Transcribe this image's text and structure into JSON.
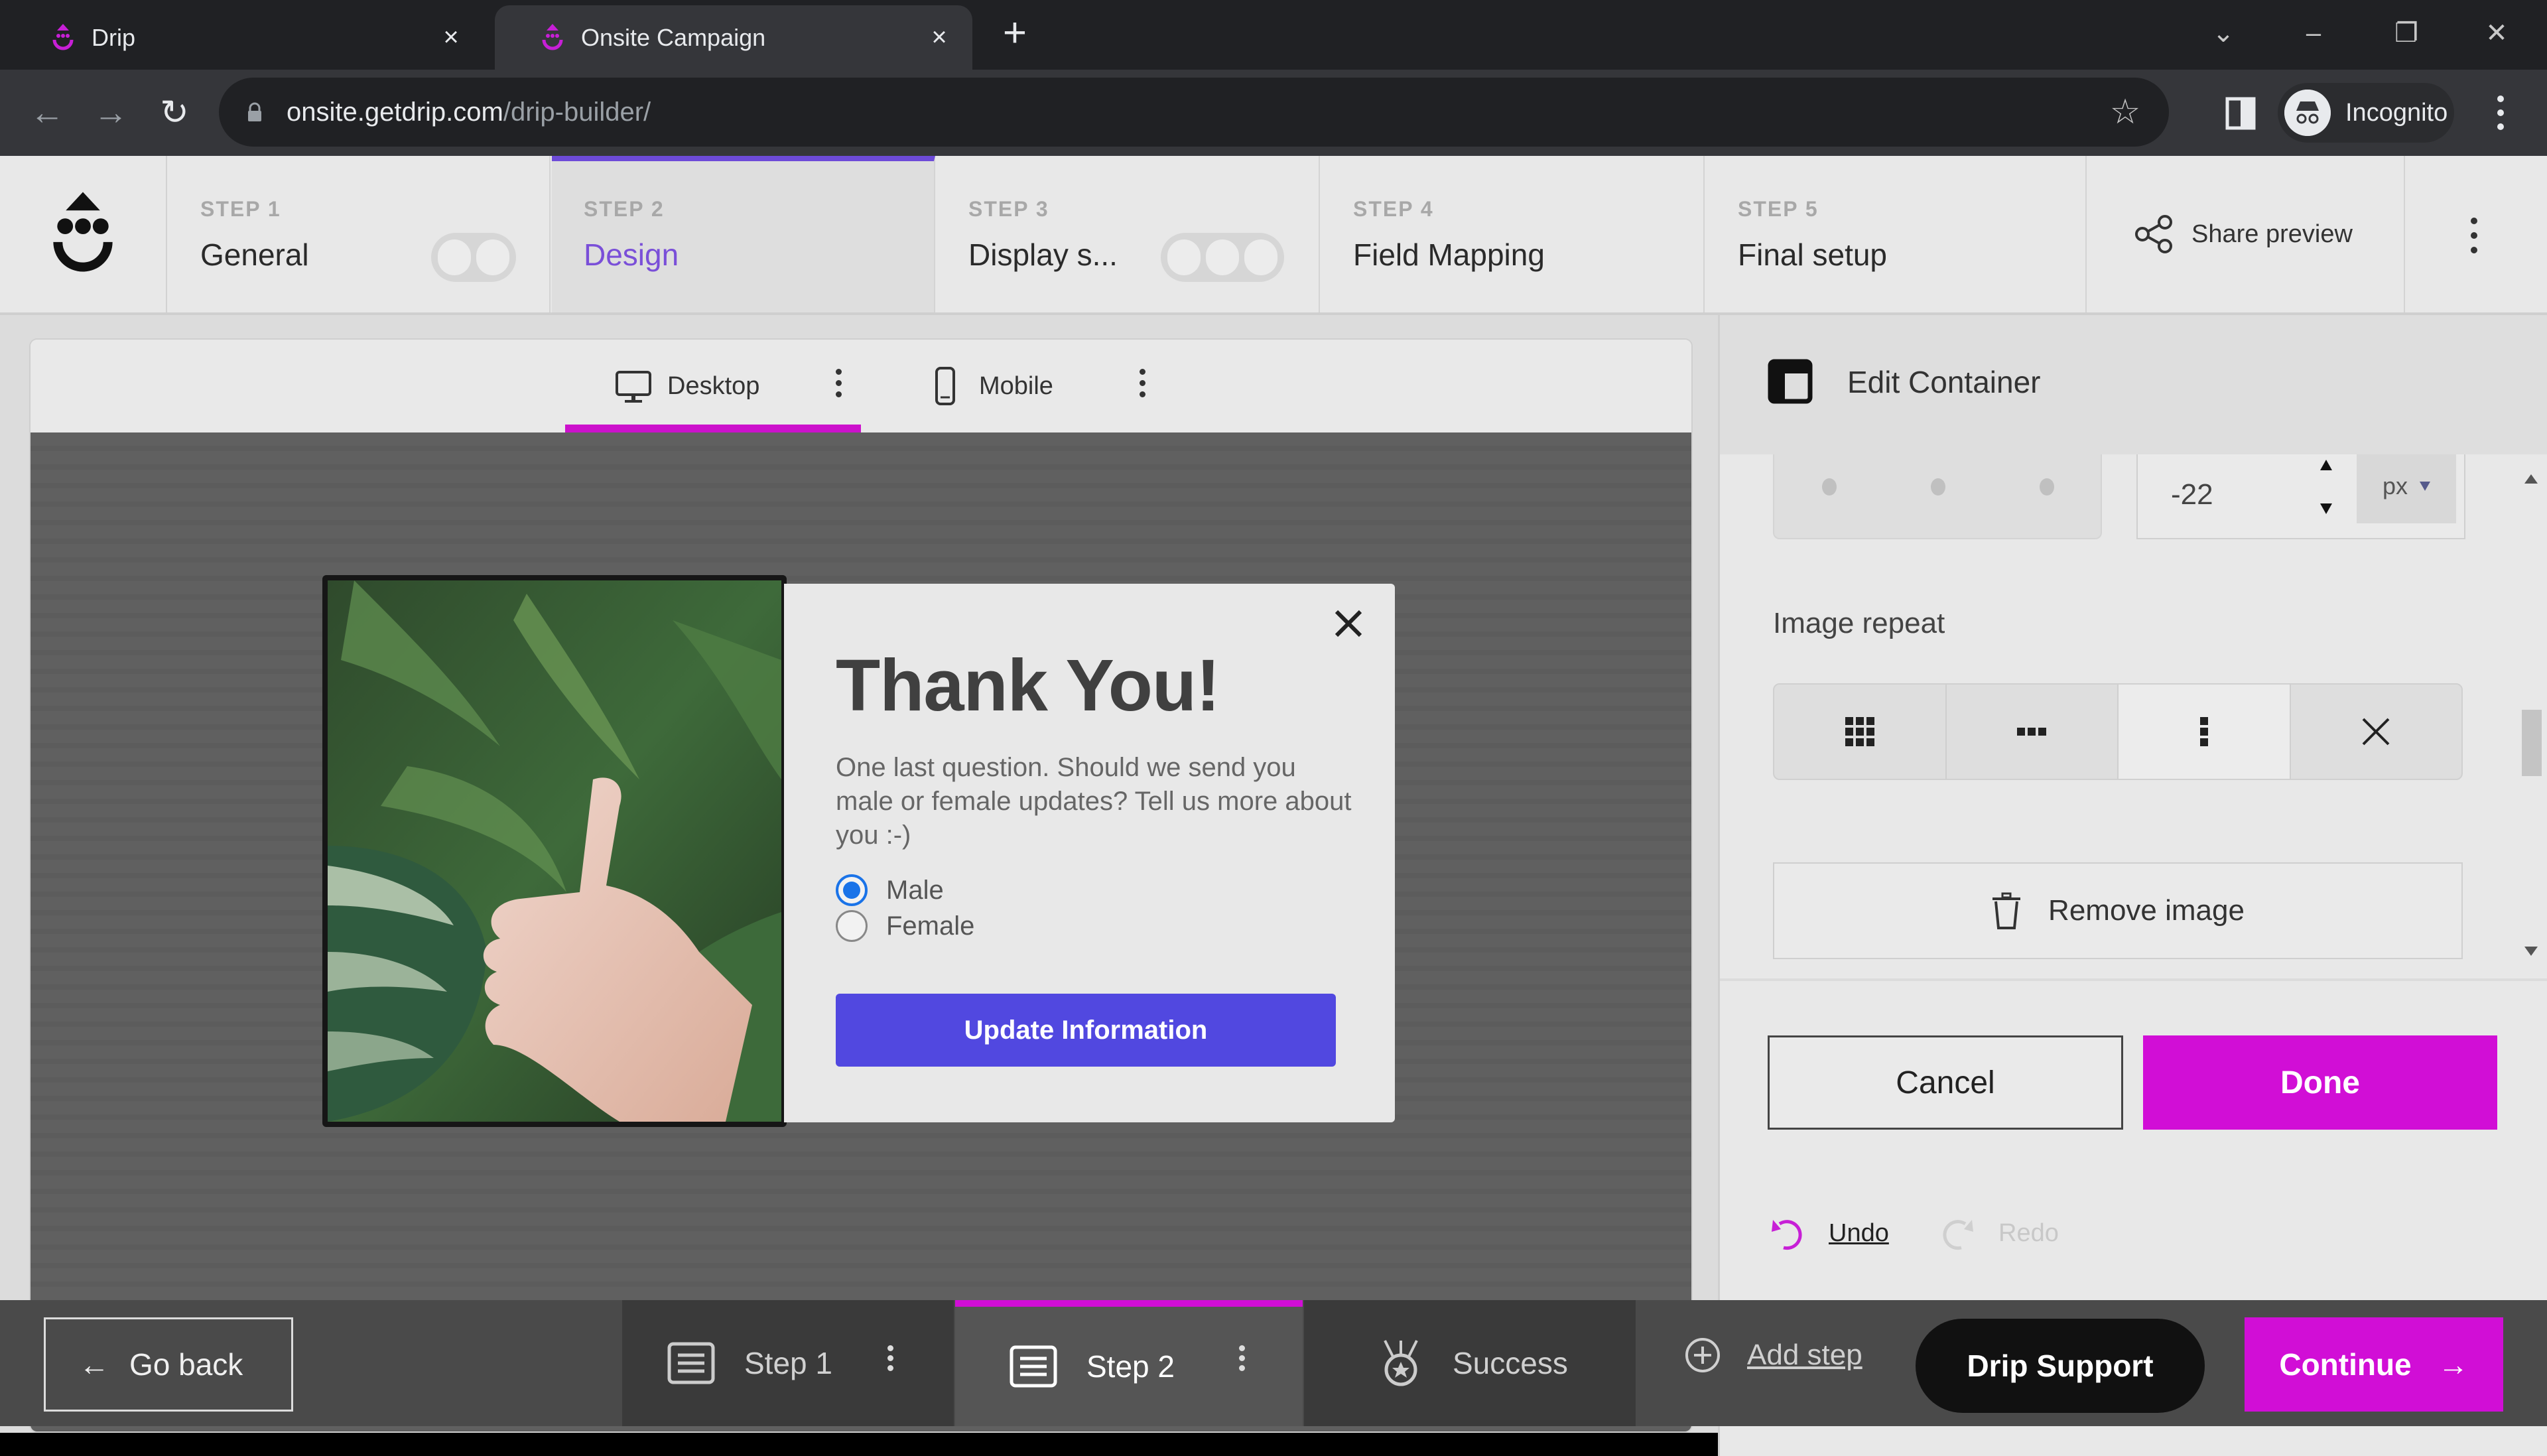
{
  "browser": {
    "tabs": [
      {
        "title": "Drip",
        "active": false
      },
      {
        "title": "Onsite Campaign",
        "active": true
      }
    ],
    "close_glyph": "×",
    "new_tab_glyph": "+",
    "url_host": "onsite.getdrip.com",
    "url_path": "/drip-builder/",
    "profile_label": "Incognito",
    "icons": {
      "back": "←",
      "forward": "→",
      "reload": "↻",
      "star": "☆",
      "tab_search": "⌄",
      "minimize": "–",
      "restore": "❐",
      "close": "✕"
    }
  },
  "header": {
    "steps": [
      {
        "number": "STEP 1",
        "name": "General",
        "has_toggle": true
      },
      {
        "number": "STEP 2",
        "name": "Design",
        "active": true
      },
      {
        "number": "STEP 3",
        "name": "Display s...",
        "has_toggle": true
      },
      {
        "number": "STEP 4",
        "name": "Field Mapping"
      },
      {
        "number": "STEP 5",
        "name": "Final setup"
      }
    ],
    "share_preview_label": "Share preview"
  },
  "preview": {
    "view_tabs": [
      {
        "label": "Desktop",
        "active": true
      },
      {
        "label": "Mobile",
        "active": false
      }
    ],
    "modal": {
      "title": "Thank You!",
      "text": "One last question. Should we send you male or female updates? Tell us more about you :-)",
      "options": [
        {
          "label": "Male",
          "checked": true
        },
        {
          "label": "Female",
          "checked": false
        }
      ],
      "submit_label": "Update Information",
      "submit_color": "#5148e0"
    }
  },
  "panel": {
    "title": "Edit Container",
    "offset_value": "-22",
    "offset_unit": "px",
    "image_repeat_label": "Image repeat",
    "repeat_options": [
      {
        "name": "repeat",
        "selected": false
      },
      {
        "name": "repeat-x",
        "selected": false
      },
      {
        "name": "repeat-y",
        "selected": true
      },
      {
        "name": "no-repeat",
        "selected": false
      }
    ],
    "remove_image_label": "Remove image",
    "cancel_label": "Cancel",
    "done_label": "Done",
    "undo_label": "Undo",
    "redo_label": "Redo"
  },
  "footer": {
    "go_back_label": "Go back",
    "flow_steps": [
      {
        "label": "Step 1",
        "current": false
      },
      {
        "label": "Step 2",
        "current": true
      },
      {
        "label": "Success",
        "current": false
      }
    ],
    "add_step_label": "Add step",
    "support_label": "Drip Support",
    "continue_label": "Continue",
    "arrow_left": "←",
    "arrow_right": "→"
  },
  "colors": {
    "accent_magenta": "#d10ed6",
    "accent_purple": "#7a4fd8",
    "radio_blue": "#1a73e8"
  }
}
